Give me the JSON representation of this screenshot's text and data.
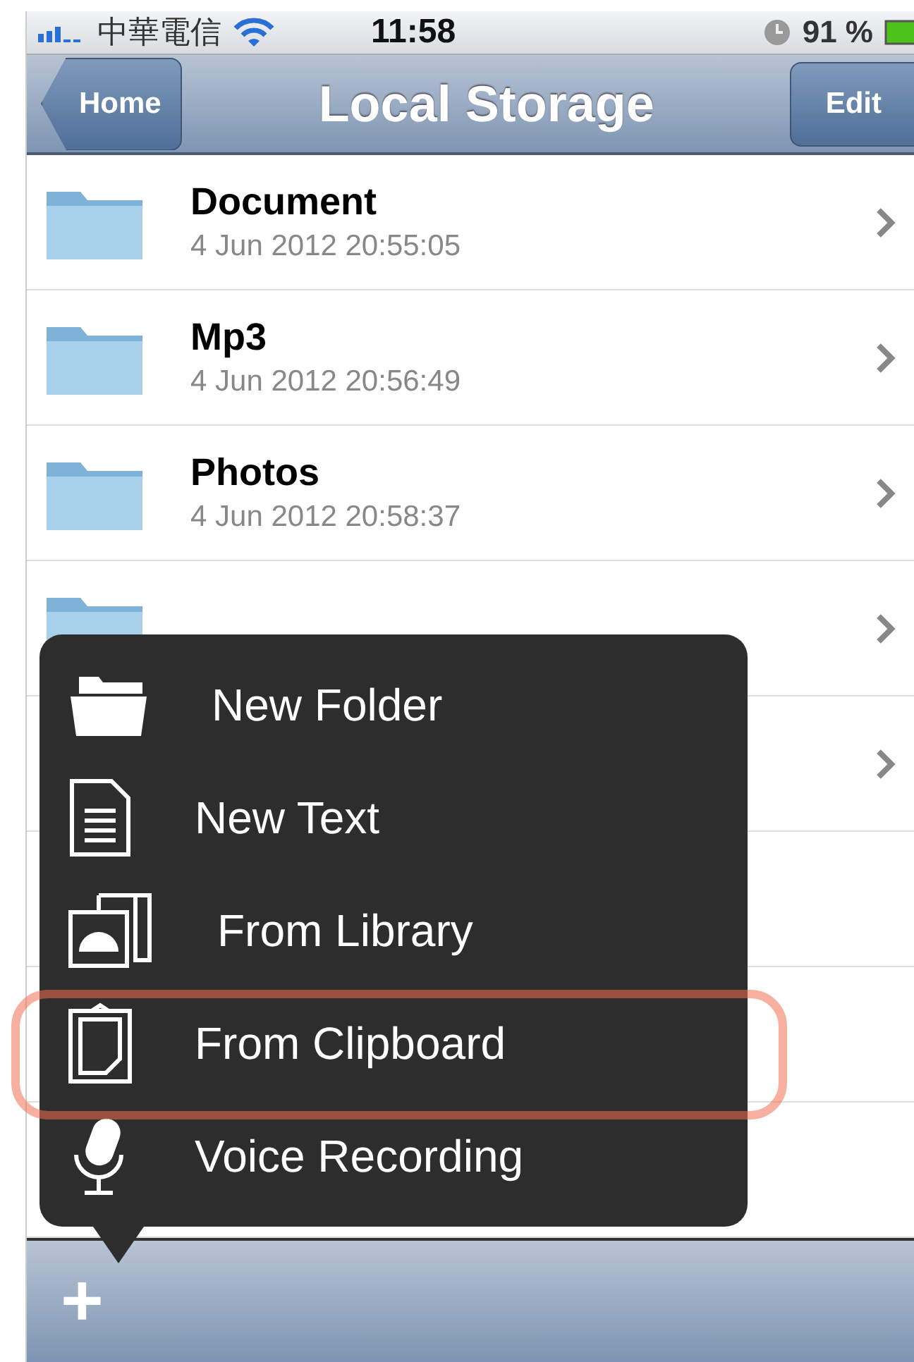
{
  "status_bar": {
    "carrier": "中華電信",
    "time": "11:58",
    "battery": "91 %"
  },
  "nav_bar": {
    "back": "Home",
    "title": "Local Storage",
    "action": "Edit"
  },
  "files": [
    {
      "name": "Document",
      "date": "4 Jun 2012 20:55:05"
    },
    {
      "name": "Mp3",
      "date": "4 Jun 2012 20:56:49"
    },
    {
      "name": "Photos",
      "date": "4 Jun 2012 20:58:37"
    }
  ],
  "popup_menu": [
    {
      "kind": "folder",
      "label": "New Folder",
      "highlighted": false
    },
    {
      "kind": "text",
      "label": "New Text",
      "highlighted": false
    },
    {
      "kind": "library",
      "label": "From Library",
      "highlighted": false
    },
    {
      "kind": "clipboard",
      "label": "From Clipboard",
      "highlighted": true
    },
    {
      "kind": "voice",
      "label": "Voice Recording",
      "highlighted": false
    }
  ],
  "toolbar": {
    "add": "+"
  }
}
